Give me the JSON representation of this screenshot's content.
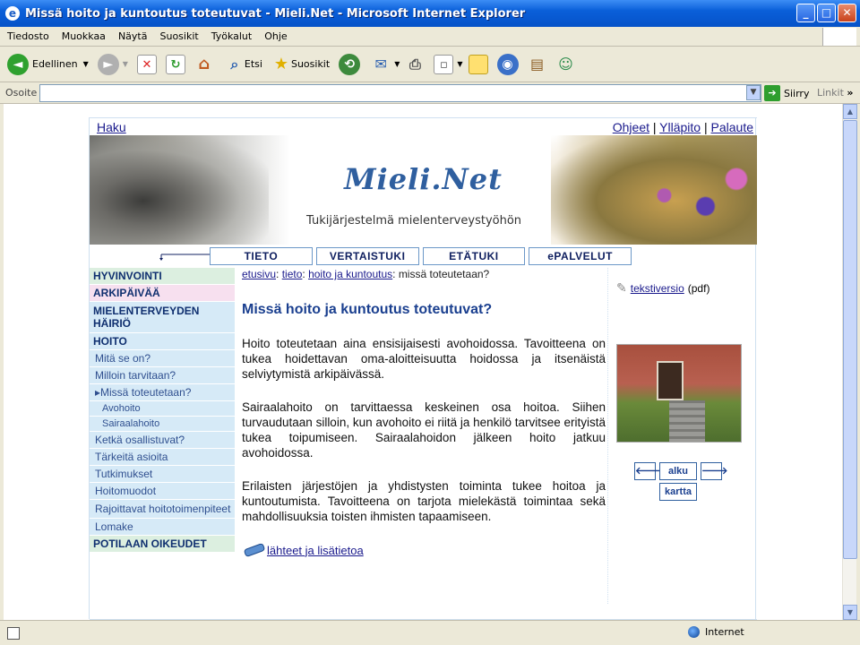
{
  "window": {
    "title": "Missä hoito ja kuntoutus toteutuvat - Mieli.Net - Microsoft Internet Explorer",
    "buttons": [
      "_",
      "□",
      "✕"
    ]
  },
  "menubar": [
    "Tiedosto",
    "Muokkaa",
    "Näytä",
    "Suosikit",
    "Työkalut",
    "Ohje"
  ],
  "toolbar": {
    "back": "Edellinen",
    "search": "Etsi",
    "favorites": "Suosikit"
  },
  "addressbar": {
    "label": "Osoite",
    "value": "",
    "go": "Siirry",
    "links": "Linkit"
  },
  "page": {
    "top_left": "Haku",
    "top_links": [
      "Ohjeet",
      "Ylläpito",
      "Palaute"
    ],
    "logo": "Mieli.Net",
    "tagline": "Tukijärjestelmä mielenterveystyöhön",
    "tabs": [
      "TIETO",
      "VERTAISTUKI",
      "ETÄTUKI",
      "ePALVELUT"
    ],
    "nav": [
      {
        "label": "HYVINVOINTI"
      },
      {
        "label": "ARKIPÄIVÄÄ"
      },
      {
        "label": "MIELENTERVEYDEN HÄIRIÖ"
      },
      {
        "label": "HOITO"
      },
      {
        "label": "Mitä se on?"
      },
      {
        "label": "Milloin tarvitaan?"
      },
      {
        "label": "▸Missä toteutetaan?"
      },
      {
        "label": "Avohoito"
      },
      {
        "label": "Sairaalahoito"
      },
      {
        "label": "Ketkä osallistuvat?"
      },
      {
        "label": "Tärkeitä asioita"
      },
      {
        "label": "Tutkimukset"
      },
      {
        "label": "Hoitomuodot"
      },
      {
        "label": "Rajoittavat hoitotoimenpiteet"
      },
      {
        "label": "Lomake"
      },
      {
        "label": "POTILAAN OIKEUDET"
      }
    ],
    "breadcrumb": {
      "c1": "etusivu",
      "c2": "tieto",
      "c3": "hoito ja kuntoutus",
      "current": "missä toteutetaan?"
    },
    "heading": "Missä hoito ja kuntoutus toteutuvat?",
    "paragraphs": [
      "Hoito toteutetaan aina ensisijaisesti avohoidossa. Tavoitteena on tukea hoidettavan oma-aloitteisuutta hoidossa ja itsenäistä selviytymistä arkipäivässä.",
      "Sairaalahoito on tarvittaessa keskeinen osa hoitoa. Siihen turvaudutaan silloin, kun avohoito ei riitä ja henkilö tarvitsee erityistä tukea toipumiseen. Sairaalahoidon jälkeen hoito jatkuu avohoidossa.",
      "Erilaisten järjestöjen ja yhdistysten toiminta tukee hoitoa ja kuntoutumista. Tavoitteena on tarjota mielekästä toimintaa sekä mahdollisuuksia toisten ihmisten tapaamiseen."
    ],
    "more_link": "lähteet ja lisätietoa",
    "text_version": "tekstiversio",
    "text_version_suffix": "(pdf)",
    "nav_buttons": {
      "prev": "🡐",
      "home": "alku",
      "next": "🡒",
      "map": "kartta"
    }
  },
  "status": {
    "zone": "Internet"
  }
}
